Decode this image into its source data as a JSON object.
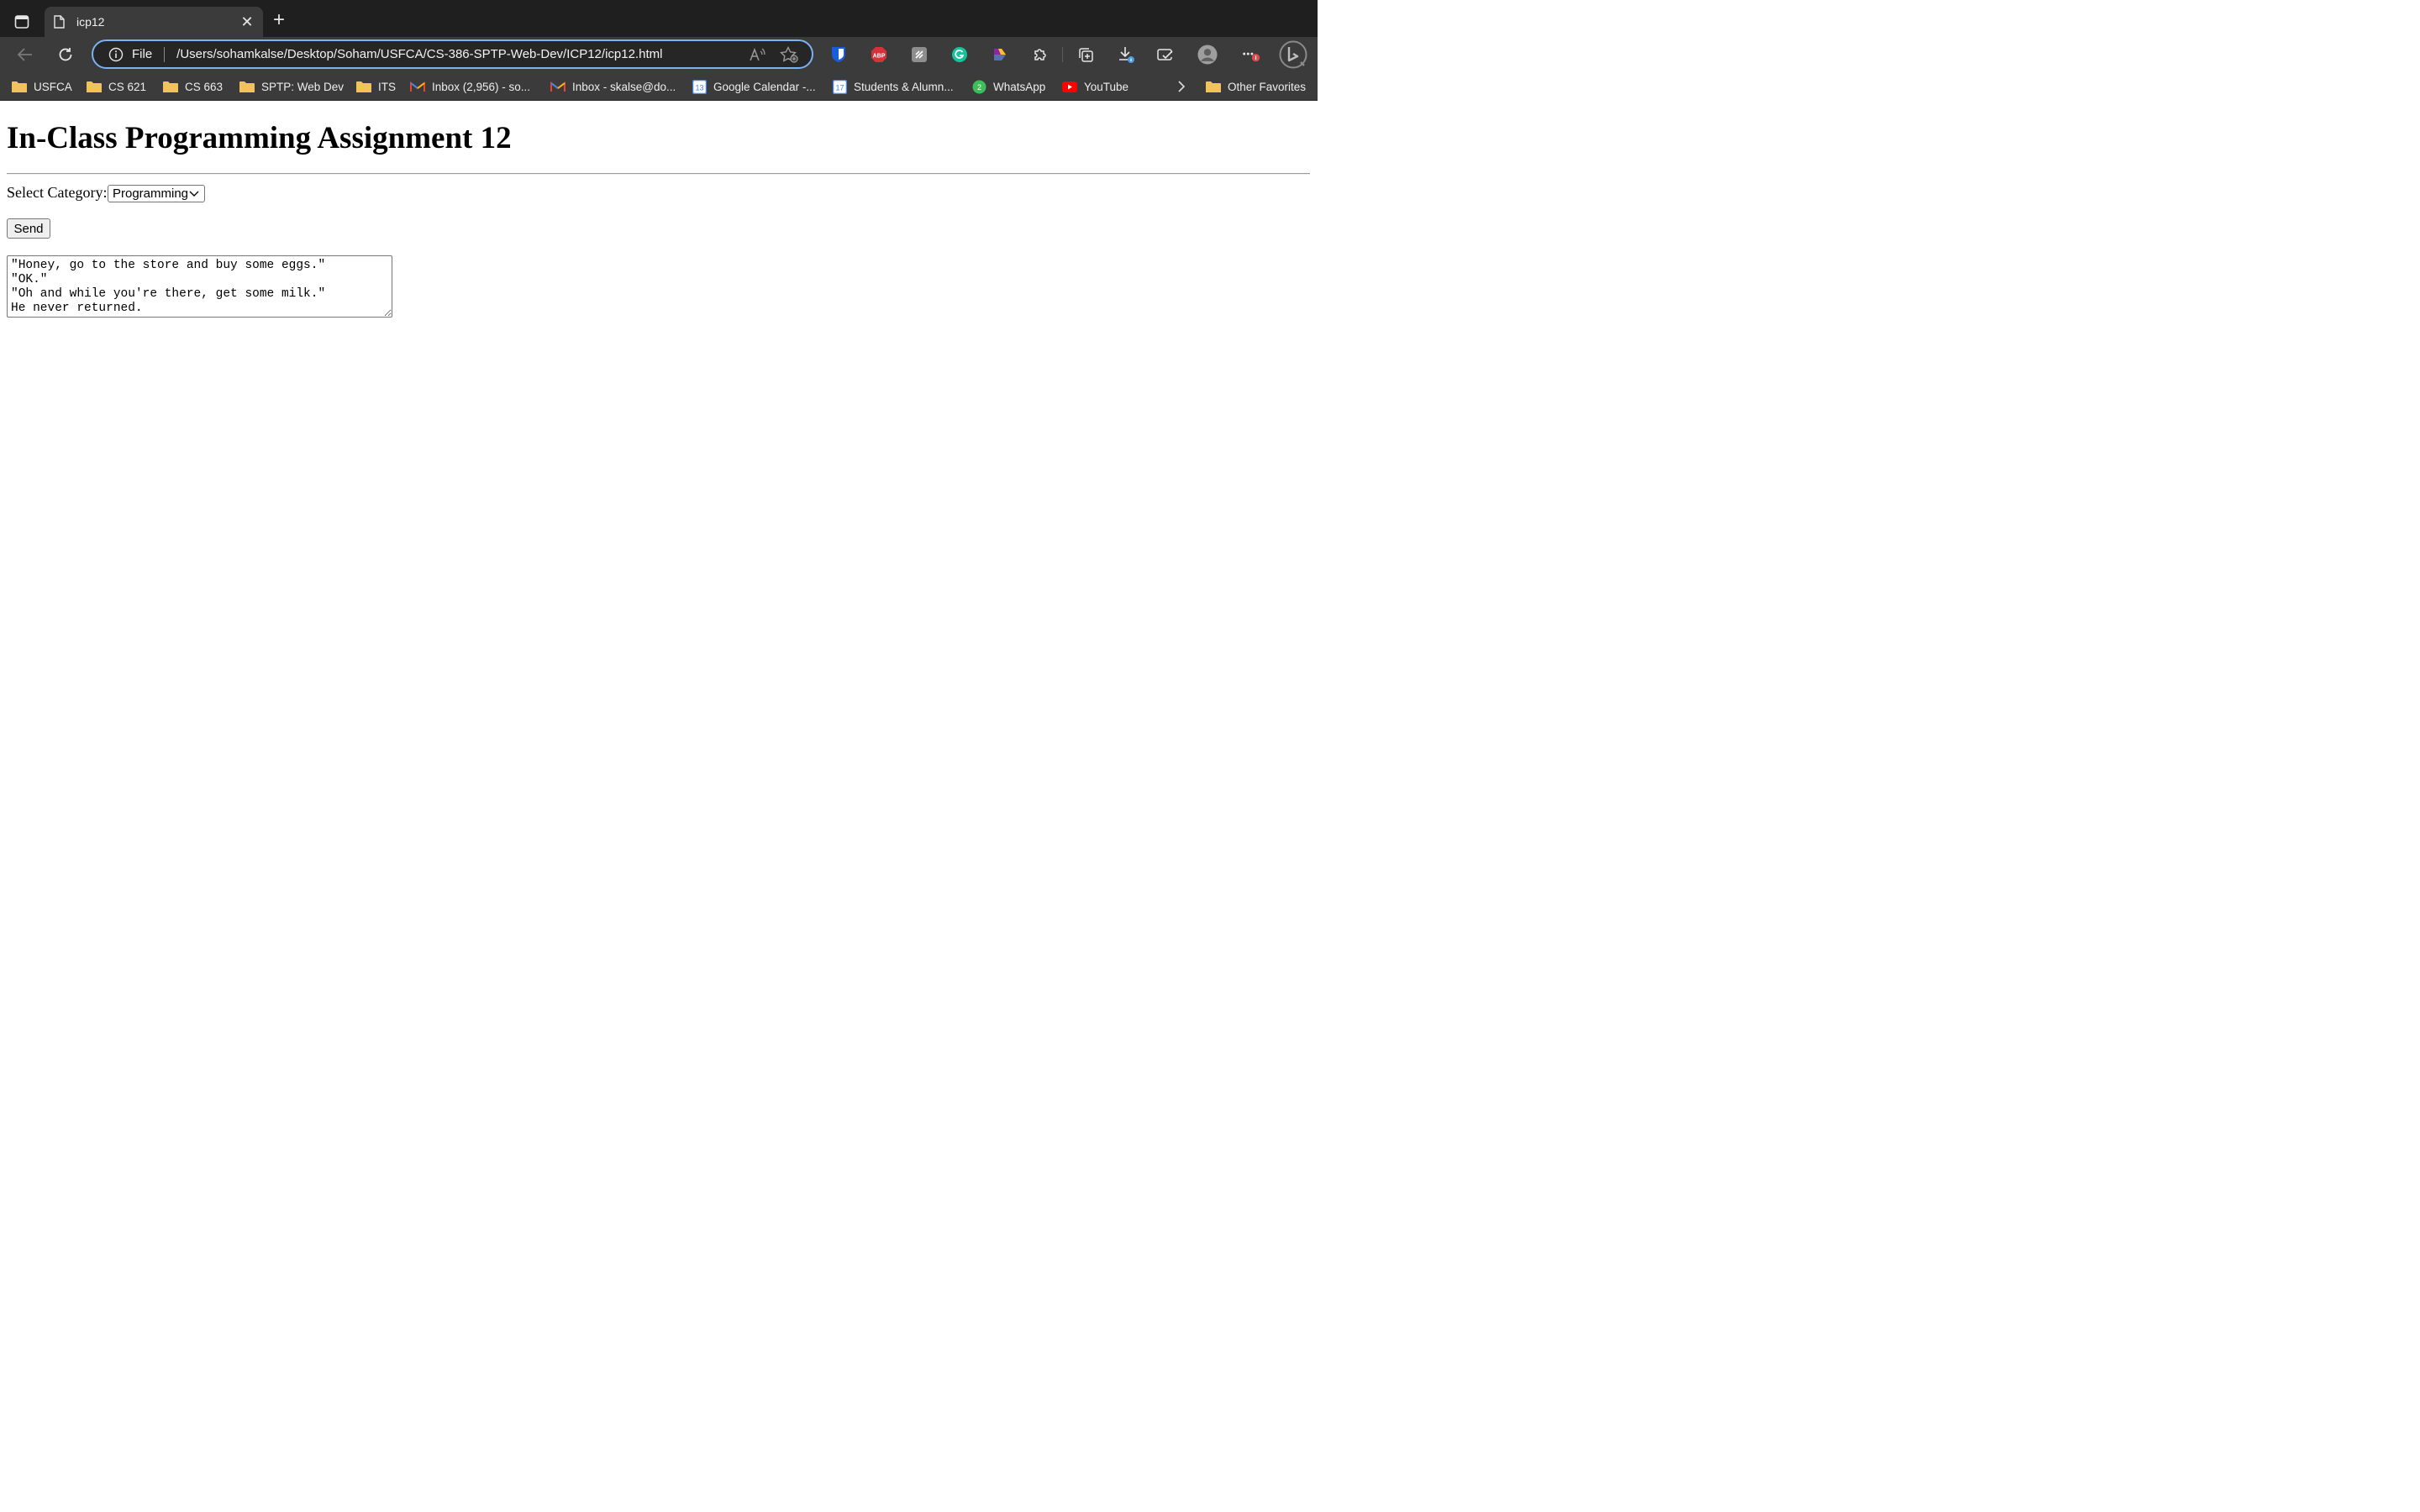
{
  "browser": {
    "tab": {
      "title": "icp12"
    },
    "address_bar": {
      "scheme": "File",
      "url": "/Users/sohamkalse/Desktop/Soham/USFCA/CS-386-SPTP-Web-Dev/ICP12/icp12.html"
    },
    "extensions": [
      "bitwarden-icon",
      "adblock-plus-icon",
      "extension-icon",
      "grammarly-icon",
      "color-picker-icon",
      "extensions-puzzle-icon",
      "collections-icon",
      "downloads-icon",
      "performance-icon",
      "profile-icon",
      "more-menu-icon",
      "copilot-icon"
    ],
    "bookmarks": [
      {
        "label": "USFCA",
        "icon": "folder-icon"
      },
      {
        "label": "CS 621",
        "icon": "folder-icon"
      },
      {
        "label": "CS 663",
        "icon": "folder-icon"
      },
      {
        "label": "SPTP: Web Dev",
        "icon": "folder-icon"
      },
      {
        "label": "ITS",
        "icon": "folder-icon"
      },
      {
        "label": "Inbox (2,956) - so...",
        "icon": "gmail-icon"
      },
      {
        "label": "Inbox - skalse@do...",
        "icon": "gmail-icon"
      },
      {
        "label": "Google Calendar -...",
        "icon": "calendar-icon",
        "badge": "13"
      },
      {
        "label": "Students & Alumn...",
        "icon": "calendar-icon",
        "badge": "17"
      },
      {
        "label": "WhatsApp",
        "icon": "whatsapp-icon",
        "badge": "2"
      },
      {
        "label": "YouTube",
        "icon": "youtube-icon"
      }
    ],
    "other_favorites": "Other Favorites",
    "colors": {
      "frame": "#1f1f1f",
      "toolbar": "#3b3b3b",
      "omnibox_border": "#7ab3f2"
    }
  },
  "page": {
    "heading": "In-Class Programming Assignment 12",
    "category_label": "Select Category:",
    "category_selected": "Programming",
    "send_label": "Send",
    "joke_text": "\"Honey, go to the store and buy some eggs.\"\n\"OK.\"\n\"Oh and while you're there, get some milk.\"\nHe never returned."
  }
}
